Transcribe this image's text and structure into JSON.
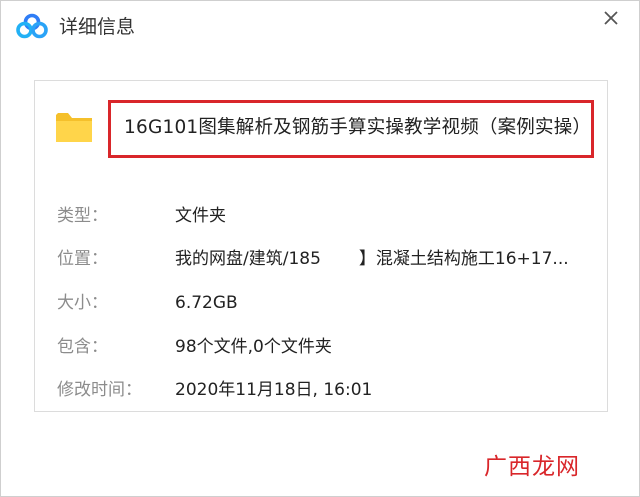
{
  "window": {
    "title": "详细信息",
    "logo_icon": "baidu-netdisk-cloud-icon",
    "close_icon": "close-icon"
  },
  "item": {
    "icon": "folder-icon",
    "name": "16G101图集解析及钢筋手算实操教学视频（案例实操）"
  },
  "properties": [
    {
      "label": "类型：",
      "value": "文件夹"
    },
    {
      "label": "位置：",
      "value_part1": "我的网盘/建筑/185",
      "value_part2": "】混凝土结构施工16+17..."
    },
    {
      "label": "大小：",
      "value": "6.72GB"
    },
    {
      "label": "包含：",
      "value": "98个文件,0个文件夹"
    },
    {
      "label": "修改时间：",
      "value": "2020年11月18日, 16:01"
    }
  ],
  "watermark": "广西龙网",
  "colors": {
    "highlight_border": "#d9262a",
    "folder": "#ffd54a",
    "label_text": "#8c8c8c",
    "value_text": "#222222"
  }
}
